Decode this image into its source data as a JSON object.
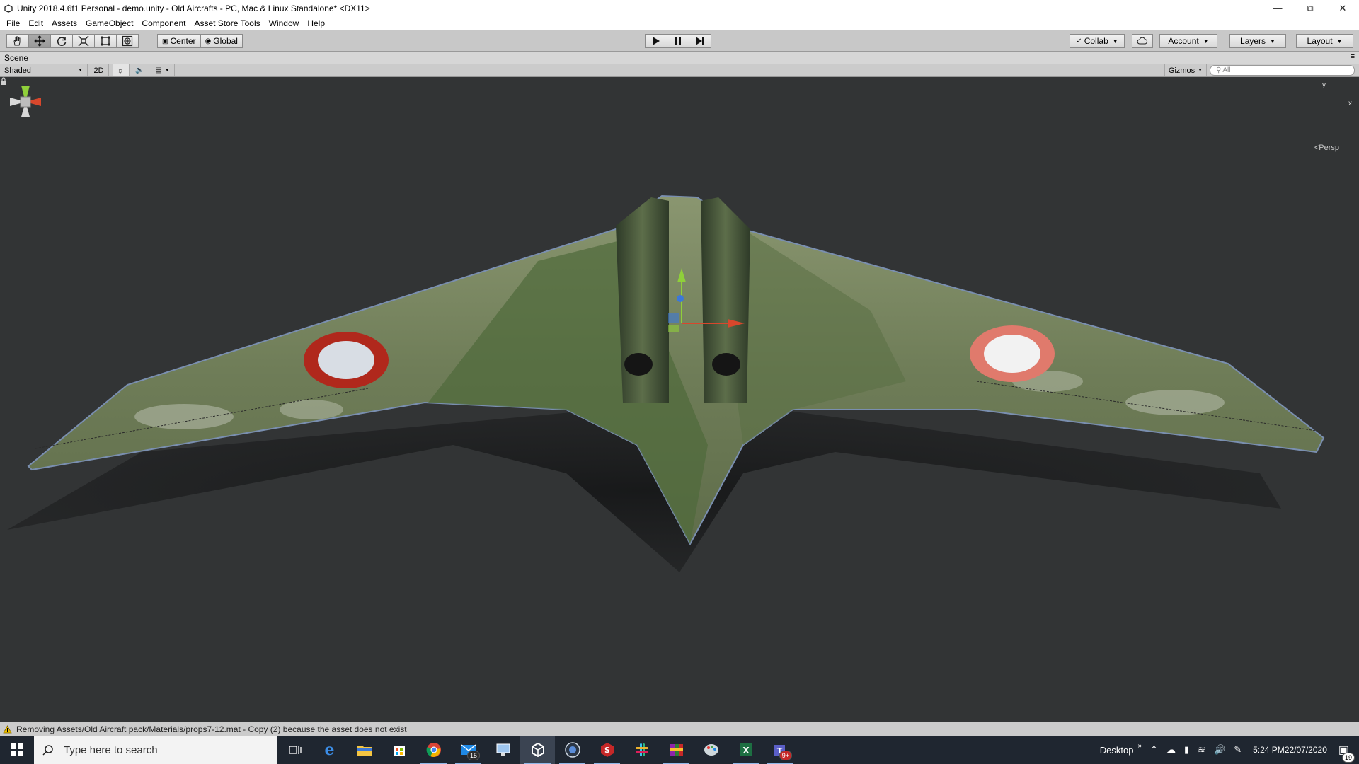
{
  "window": {
    "title": "Unity 2018.4.6f1 Personal - demo.unity - Old Aircrafts - PC, Mac & Linux Standalone* <DX11>",
    "minimize_icon": "minimize-icon",
    "restore_icon": "restore-icon",
    "close_icon": "close-icon"
  },
  "menu": {
    "items": [
      "File",
      "Edit",
      "Assets",
      "GameObject",
      "Component",
      "Asset Store Tools",
      "Window",
      "Help"
    ]
  },
  "toolbar": {
    "tools": [
      "hand-tool-icon",
      "move-tool-icon",
      "rotate-tool-icon",
      "scale-tool-icon",
      "rect-tool-icon",
      "transform-tool-icon"
    ],
    "active_tool": "move-tool-icon",
    "pivot_label": "Center",
    "space_label": "Global",
    "play_icon": "play-icon",
    "pause_icon": "pause-icon",
    "step_icon": "step-icon",
    "collab_label": "Collab",
    "account_label": "Account",
    "layers_label": "Layers",
    "layout_label": "Layout"
  },
  "scene": {
    "tab_label": "Scene",
    "shading_mode": "Shaded",
    "mode_2d": "2D",
    "gizmos_label": "Gizmos",
    "search_placeholder": "All",
    "persp_label": "Persp",
    "gizmo_axis_y": "y",
    "gizmo_axis_x": "x"
  },
  "status": {
    "message": "Removing Assets/Old Aircraft pack/Materials/props7-12.mat - Copy (2) because the asset does not exist"
  },
  "taskbar": {
    "search_placeholder": "Type here to search",
    "mail_badge": "15",
    "teams_badge": "9+",
    "desktop_label": "Desktop",
    "time": "5:24 PM",
    "date": "22/07/2020",
    "notification_badge": "19"
  },
  "colors": {
    "scene_bg": "#323435",
    "aircraft_green": "#6b7b52",
    "roundel_red": "#b0281c",
    "taskbar_bg": "#1f2630"
  }
}
